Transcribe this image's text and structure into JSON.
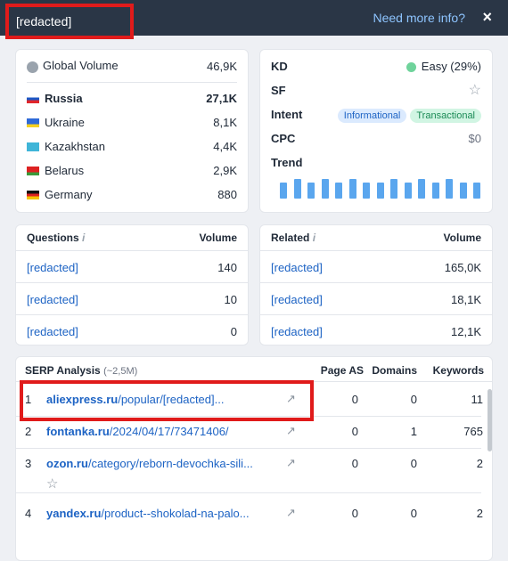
{
  "header": {
    "keyword": "[redacted]",
    "more_info": "Need more info?",
    "close": "×"
  },
  "volume": {
    "global_label": "Global Volume",
    "global_value": "46,9K",
    "countries": [
      {
        "name": "Russia",
        "value": "27,1K",
        "bold": true
      },
      {
        "name": "Ukraine",
        "value": "8,1K"
      },
      {
        "name": "Kazakhstan",
        "value": "4,4K"
      },
      {
        "name": "Belarus",
        "value": "2,9K"
      },
      {
        "name": "Germany",
        "value": "880"
      }
    ]
  },
  "metrics": {
    "kd_label": "KD",
    "kd_value": "Easy (29%)",
    "kd_color": "#6fd39b",
    "sf_label": "SF",
    "intent_label": "Intent",
    "intent_tags": [
      "Informational",
      "Transactional"
    ],
    "cpc_label": "CPC",
    "cpc_value": "$0",
    "trend_label": "Trend",
    "trend": [
      0.8,
      1,
      0.8,
      1,
      0.8,
      1,
      0.8,
      0.8,
      1,
      0.8,
      1,
      0.8,
      1,
      0.8,
      0.8
    ]
  },
  "questions": {
    "header": "Questions",
    "volume_header": "Volume",
    "items": [
      {
        "text": "[redacted]",
        "volume": "140"
      },
      {
        "text": "[redacted]",
        "volume": "10"
      },
      {
        "text": "[redacted]",
        "volume": "0"
      }
    ]
  },
  "related": {
    "header": "Related",
    "volume_header": "Volume",
    "items": [
      {
        "text": "[redacted]",
        "volume": "165,0K"
      },
      {
        "text": "[redacted]",
        "volume": "18,1K"
      },
      {
        "text": "[redacted]",
        "volume": "12,1K"
      }
    ]
  },
  "serp": {
    "header": "SERP Analysis",
    "count": "(~2,5M)",
    "columns": [
      "Page AS",
      "Domains",
      "Keywords"
    ],
    "rows": [
      {
        "rank": "1",
        "domain": "aliexpress.ru",
        "path": "/popular/[redacted]...",
        "page_as": "0",
        "domains": "0",
        "keywords": "11"
      },
      {
        "rank": "2",
        "domain": "fontanka.ru",
        "path": "/2024/04/17/73471406/",
        "page_as": "0",
        "domains": "1",
        "keywords": "765"
      },
      {
        "rank": "3",
        "domain": "ozon.ru",
        "path": "/category/reborn-devochka-sili...",
        "page_as": "0",
        "domains": "0",
        "keywords": "2"
      },
      {
        "rank": "4",
        "domain": "yandex.ru",
        "path": "/product--shokolad-na-palo...",
        "page_as": "0",
        "domains": "0",
        "keywords": "2"
      }
    ]
  }
}
